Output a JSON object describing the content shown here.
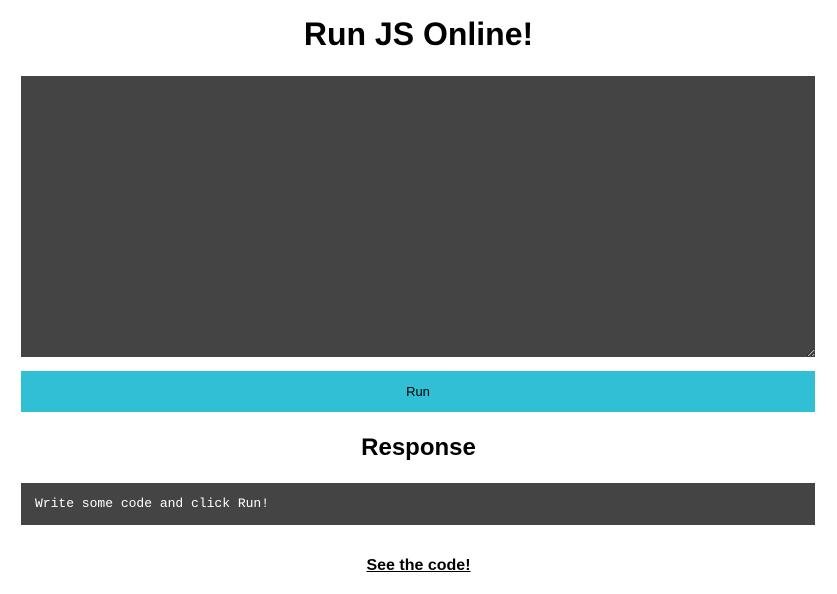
{
  "header": {
    "title": "Run JS Online!"
  },
  "editor": {
    "value": "",
    "background": "#444444"
  },
  "actions": {
    "run_label": "Run",
    "run_color": "#31bfd5"
  },
  "response": {
    "heading": "Response",
    "output": "Write some code and click Run!",
    "background": "#444444"
  },
  "footer": {
    "link_label": "See the code!"
  }
}
